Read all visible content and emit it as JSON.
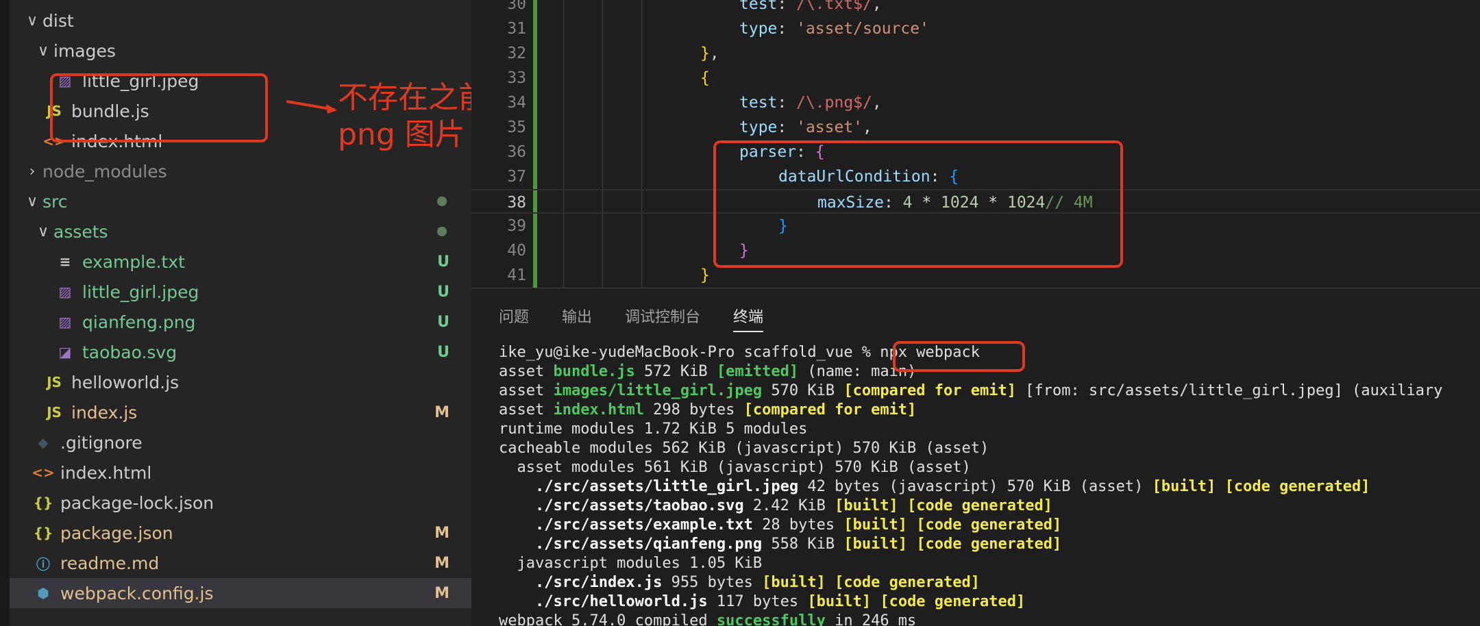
{
  "explorer": {
    "items": [
      {
        "label": "dist",
        "chev": "∨",
        "icon": "",
        "color": "#cccccc",
        "badge": "",
        "dot": false,
        "indent": 0
      },
      {
        "label": "images",
        "chev": "∨",
        "icon": "",
        "color": "#cccccc",
        "badge": "",
        "dot": false,
        "indent": 1
      },
      {
        "label": "little_girl.jpeg",
        "chev": "",
        "icon": "img",
        "color": "#cccccc",
        "badge": "",
        "dot": false,
        "indent": 2
      },
      {
        "label": "bundle.js",
        "chev": "",
        "icon": "JS",
        "color": "#cccccc",
        "badge": "",
        "dot": false,
        "indent": 1
      },
      {
        "label": "index.html",
        "chev": "",
        "icon": "<>",
        "color": "#cccccc",
        "badge": "",
        "dot": false,
        "indent": 1
      },
      {
        "label": "node_modules",
        "chev": "›",
        "icon": "",
        "color": "#8b8b8b",
        "badge": "",
        "dot": false,
        "indent": 0
      },
      {
        "label": "src",
        "chev": "∨",
        "icon": "",
        "color": "#73c991",
        "badge": "",
        "dot": true,
        "indent": 0
      },
      {
        "label": "assets",
        "chev": "∨",
        "icon": "",
        "color": "#73c991",
        "badge": "",
        "dot": true,
        "indent": 1
      },
      {
        "label": "example.txt",
        "chev": "",
        "icon": "≡",
        "color": "#73c991",
        "badge": "U",
        "dot": false,
        "indent": 2
      },
      {
        "label": "little_girl.jpeg",
        "chev": "",
        "icon": "img",
        "color": "#73c991",
        "badge": "U",
        "dot": false,
        "indent": 2
      },
      {
        "label": "qianfeng.png",
        "chev": "",
        "icon": "img",
        "color": "#73c991",
        "badge": "U",
        "dot": false,
        "indent": 2
      },
      {
        "label": "taobao.svg",
        "chev": "",
        "icon": "svg",
        "color": "#73c991",
        "badge": "U",
        "dot": false,
        "indent": 2
      },
      {
        "label": "helloworld.js",
        "chev": "",
        "icon": "JS",
        "color": "#cccccc",
        "badge": "",
        "dot": false,
        "indent": 1
      },
      {
        "label": "index.js",
        "chev": "",
        "icon": "JS",
        "color": "#e2c08d",
        "badge": "M",
        "dot": false,
        "indent": 1
      },
      {
        "label": ".gitignore",
        "chev": "",
        "icon": "git",
        "color": "#cccccc",
        "badge": "",
        "dot": false,
        "indent": 0
      },
      {
        "label": "index.html",
        "chev": "",
        "icon": "<>",
        "color": "#cccccc",
        "badge": "",
        "dot": false,
        "indent": 0
      },
      {
        "label": "package-lock.json",
        "chev": "",
        "icon": "{}",
        "color": "#cccccc",
        "badge": "",
        "dot": false,
        "indent": 0
      },
      {
        "label": "package.json",
        "chev": "",
        "icon": "{}",
        "color": "#e2c08d",
        "badge": "M",
        "dot": false,
        "indent": 0
      },
      {
        "label": "readme.md",
        "chev": "",
        "icon": "i",
        "color": "#e2c08d",
        "badge": "M",
        "dot": false,
        "indent": 0
      },
      {
        "label": "webpack.config.js",
        "chev": "",
        "icon": "cfg",
        "color": "#e2c08d",
        "badge": "M",
        "dot": false,
        "indent": 0,
        "selected": true
      }
    ]
  },
  "annotation": {
    "line1": "不存在之前的",
    "line2": "png 图片",
    "color": "#e0391f"
  },
  "editor": {
    "lines": [
      {
        "n": "30",
        "html": "<span class='t-key'>test</span>: <span class='t-regex'>/\\.txt$/</span>,"
      },
      {
        "n": "31",
        "html": "<span class='t-key'>type</span>: <span class='t-str'>'asset/source'</span>"
      },
      {
        "n": "32",
        "html": "<span class='t-brace1'>}</span>,"
      },
      {
        "n": "33",
        "html": "<span class='t-brace1'>{</span>"
      },
      {
        "n": "34",
        "html": "<span class='t-key'>test</span>: <span class='t-regex'>/\\.png$/</span>,"
      },
      {
        "n": "35",
        "html": "<span class='t-key'>type</span>: <span class='t-str'>'asset'</span>,"
      },
      {
        "n": "36",
        "html": "<span class='t-key'>parser</span>: <span class='t-brace2'>{</span>"
      },
      {
        "n": "37",
        "html": "<span class='t-key'>dataUrlCondition</span>: <span class='t-brace3'>{</span>"
      },
      {
        "n": "38",
        "html": "<span class='t-key'>maxSize</span>: <span class='t-num'>4</span> * <span class='t-num'>1024</span> * <span class='t-num'>1024</span><span class='t-cmt'>// 4M</span>"
      },
      {
        "n": "39",
        "html": "<span class='t-brace3'>}</span>"
      },
      {
        "n": "40",
        "html": "<span class='t-brace2'>}</span>"
      },
      {
        "n": "41",
        "html": "<span class='t-brace1'>}</span>"
      }
    ],
    "indents": [
      5,
      5,
      4,
      4,
      5,
      5,
      5,
      6,
      7,
      6,
      5,
      4
    ],
    "current_line": "38"
  },
  "panel": {
    "tabs": [
      "问题",
      "输出",
      "调试控制台",
      "终端"
    ],
    "active_tab": "终端"
  },
  "terminal": {
    "lines": [
      "ike_yu@ike-yudeMacBook-Pro scaffold_vue % npx webpack",
      "asset <span class='tg'>bundle.js</span> 572 KiB <span class='tg'>[emitted]</span> (name: main)",
      "asset <span class='tg'>images/little_girl.jpeg</span> 570 KiB <span class='ty'>[compared for emit]</span> [from: src/assets/little_girl.jpeg] (auxiliary",
      "asset <span class='tg'>index.html</span> 298 bytes <span class='ty'>[compared for emit]</span>",
      "runtime modules 1.72 KiB 5 modules",
      "cacheable modules 562 KiB (javascript) 570 KiB (asset)",
      "  asset modules 561 KiB (javascript) 570 KiB (asset)",
      "    <span class='tb'>./src/assets/little_girl.jpeg</span> 42 bytes (javascript) 570 KiB (asset) <span class='ty'>[built]</span> <span class='ty'>[code generated]</span>",
      "    <span class='tb'>./src/assets/taobao.svg</span> 2.42 KiB <span class='ty'>[built]</span> <span class='ty'>[code generated]</span>",
      "    <span class='tb'>./src/assets/example.txt</span> 28 bytes <span class='ty'>[built]</span> <span class='ty'>[code generated]</span>",
      "    <span class='tb'>./src/assets/qianfeng.png</span> 558 KiB <span class='ty'>[built]</span> <span class='ty'>[code generated]</span>",
      "  javascript modules 1.05 KiB",
      "    <span class='tb'>./src/index.js</span> 955 bytes <span class='ty'>[built]</span> <span class='ty'>[code generated]</span>",
      "    <span class='tb'>./src/helloworld.js</span> 117 bytes <span class='ty'>[built]</span> <span class='ty'>[code generated]</span>",
      "webpack 5.74.0 compiled <span class='tg'>successfully</span> in 246 ms"
    ]
  }
}
